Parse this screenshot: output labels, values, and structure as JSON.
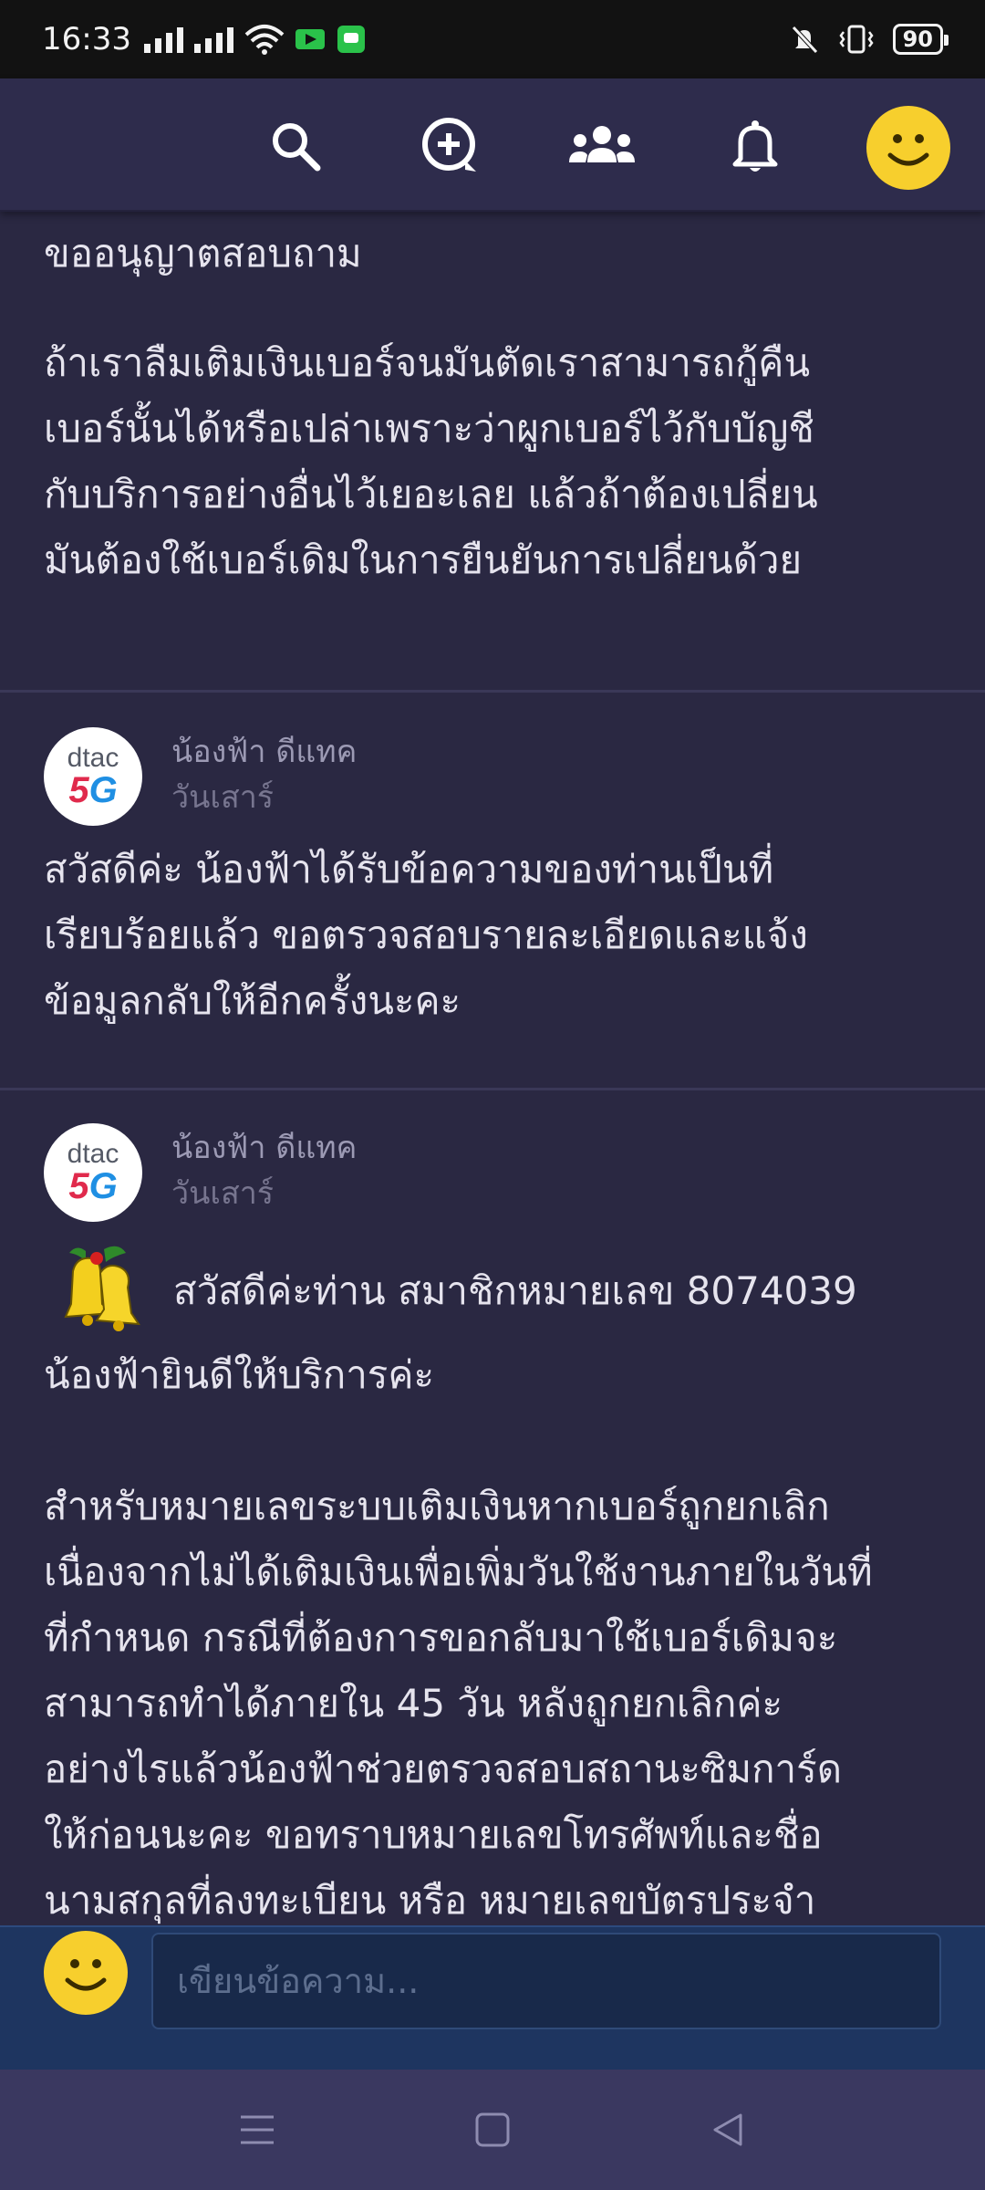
{
  "status": {
    "time": "16:33",
    "battery": "90"
  },
  "app_bar": {
    "icons": [
      "search-icon",
      "add-post-icon",
      "community-icon",
      "notification-bell-icon",
      "profile-avatar-icon"
    ]
  },
  "post": {
    "title": "ขออนุญาตสอบถาม",
    "body_lines": [
      "ถ้าเราลืมเติมเงินเบอร์จนมันตัดเราสามารถกู้คืน",
      "เบอร์นั้นได้หรือเปล่าเพราะว่าผูกเบอร์ไว้กับบัญชี",
      "กับบริการอย่างอื่นไว้เยอะเลย แล้วถ้าต้องเปลี่ยน",
      "มันต้องใช้เบอร์เดิมในการยืนยันการเปลี่ยนด้วย"
    ]
  },
  "replies": [
    {
      "author": "น้องฟ้า ดีแทค",
      "date": "วันเสาร์",
      "logo_top": "dtac",
      "logo_bottom_a": "5",
      "logo_bottom_b": "G",
      "body_lines": [
        "สวัสดีค่ะ น้องฟ้าได้รับข้อความของท่านเป็นที่",
        "เรียบร้อยแล้ว ขอตรวจสอบรายละเอียดและแจ้ง",
        "ข้อมูลกลับให้อีกครั้งนะคะ"
      ]
    },
    {
      "author": "น้องฟ้า ดีแทค",
      "date": "วันเสาร์",
      "logo_top": "dtac",
      "logo_bottom_a": "5",
      "logo_bottom_b": "G",
      "greeting": "สวัสดีค่ะท่าน  สมาชิกหมายเลข 8074039",
      "greeting_line2": "น้องฟ้ายินดีให้บริการค่ะ",
      "body_lines": [
        "สำหรับหมายเลขระบบเติมเงินหากเบอร์ถูกยกเลิก",
        "เนื่องจากไม่ได้เติมเงินเพื่อเพิ่มวันใช้งานภายในวันที่",
        "ที่กำหนด กรณีที่ต้องการขอกลับมาใช้เบอร์เดิมจะ",
        "สามารถทำได้ภายใน 45 วัน หลังถูกยกเลิกค่ะ",
        "อย่างไรแล้วน้องฟ้าช่วยตรวจสอบสถานะซิมการ์ด",
        "ให้ก่อนนะคะ ขอทราบหมายเลขโทรศัพท์และชื่อ",
        "นามสกุลที่ลงทะเบียน หรือ หมายเลขบัตรประจำ"
      ]
    }
  ],
  "compose": {
    "placeholder": "เขียนข้อความ..."
  }
}
